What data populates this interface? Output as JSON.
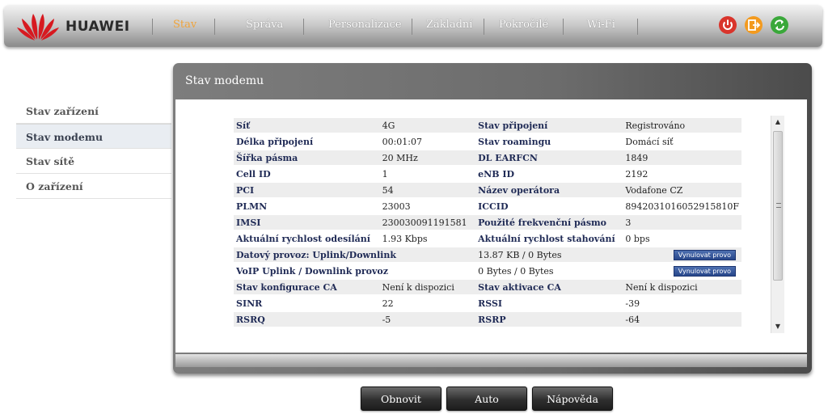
{
  "brand": {
    "name": "HUAWEI"
  },
  "nav": {
    "items": [
      {
        "label": "Stav",
        "active": true
      },
      {
        "label": "Správa",
        "active": false
      },
      {
        "label": "Personalizace",
        "active": false
      },
      {
        "label": "Základní",
        "active": false
      },
      {
        "label": "Pokročilé",
        "active": false
      },
      {
        "label": "Wi-Fi",
        "active": false
      }
    ]
  },
  "top_icons": [
    {
      "icon": "power-icon",
      "color": "#d9342b"
    },
    {
      "icon": "logout-icon",
      "color": "#f39a1e"
    },
    {
      "icon": "refresh-icon",
      "color": "#3aa83a"
    }
  ],
  "sidebar": {
    "items": [
      {
        "label": "Stav zařízení",
        "selected": false
      },
      {
        "label": "Stav modemu",
        "selected": true
      },
      {
        "label": "Stav sítě",
        "selected": false
      },
      {
        "label": "O zařízení",
        "selected": false
      }
    ]
  },
  "panel": {
    "title": "Stav modemu"
  },
  "status": {
    "reset_label": "Vynulovat provo",
    "rows": [
      [
        "Síť",
        "4G",
        "Stav připojení",
        "Registrováno"
      ],
      [
        "Délka připojení",
        "00:01:07",
        "Stav roamingu",
        "Domácí síť"
      ],
      [
        "Šířka pásma",
        "20 MHz",
        "DL EARFCN",
        "1849"
      ],
      [
        "Cell ID",
        "1",
        "eNB ID",
        "2192"
      ],
      [
        "PCI",
        "54",
        "Název operátora",
        "Vodafone CZ"
      ],
      [
        "PLMN",
        "23003",
        "ICCID",
        "8942031016052915810F"
      ],
      [
        "IMSI",
        "230030091191581",
        "Použité frekvenční pásmo",
        "3"
      ],
      [
        "Aktuální rychlost odesílání",
        "1.93 Kbps",
        "Aktuální rychlost stahování",
        "0 bps"
      ],
      [
        "Stav konfigurace CA",
        "Není k dispozici",
        "Stav aktivace CA",
        "Není k dispozici"
      ],
      [
        "SINR",
        "22",
        "RSSI",
        "-39"
      ],
      [
        "RSRQ",
        "-5",
        "RSRP",
        "-64"
      ]
    ],
    "traffic": {
      "data_label": "Datový provoz: Uplink/Downlink",
      "data_value": "13.87 KB  /  0 Bytes",
      "voip_label": "VoIP Uplink / Downlink provoz",
      "voip_value": "0 Bytes  /  0 Bytes"
    }
  },
  "buttons": {
    "refresh": "Obnovit",
    "auto": "Auto",
    "help": "Nápověda"
  },
  "colors": {
    "accent": "#f0a43b",
    "label": "#1f2a55",
    "reset_button": "#2f4f94"
  }
}
